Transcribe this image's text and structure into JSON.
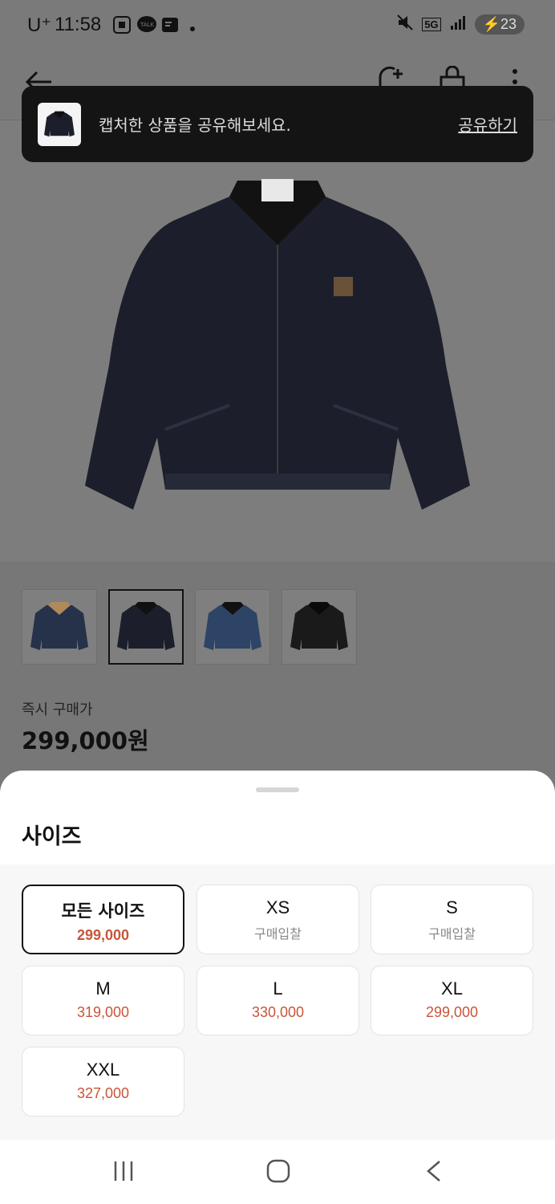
{
  "status_bar": {
    "carrier": "U⁺",
    "time": "11:58",
    "network": "5G",
    "battery": "23"
  },
  "toast": {
    "message": "캡처한 상품을 공유해보세요.",
    "action": "공유하기"
  },
  "product": {
    "price_label": "즉시 구매가",
    "price": "299,000원",
    "thumbnails": [
      "thumb-1",
      "thumb-2",
      "thumb-3",
      "thumb-4"
    ],
    "selected_thumbnail": 1
  },
  "size_sheet": {
    "title": "사이즈",
    "options": [
      {
        "size": "모든 사이즈",
        "price": "299,000",
        "selected": true
      },
      {
        "size": "XS",
        "price": "구매입찰"
      },
      {
        "size": "S",
        "price": "구매입찰"
      },
      {
        "size": "M",
        "price": "319,000"
      },
      {
        "size": "L",
        "price": "330,000"
      },
      {
        "size": "XL",
        "price": "299,000"
      },
      {
        "size": "XXL",
        "price": "327,000"
      }
    ]
  },
  "colors": {
    "price_accent": "#c8553a",
    "overlay": "#7a7a7a",
    "toast_bg": "#141414"
  }
}
